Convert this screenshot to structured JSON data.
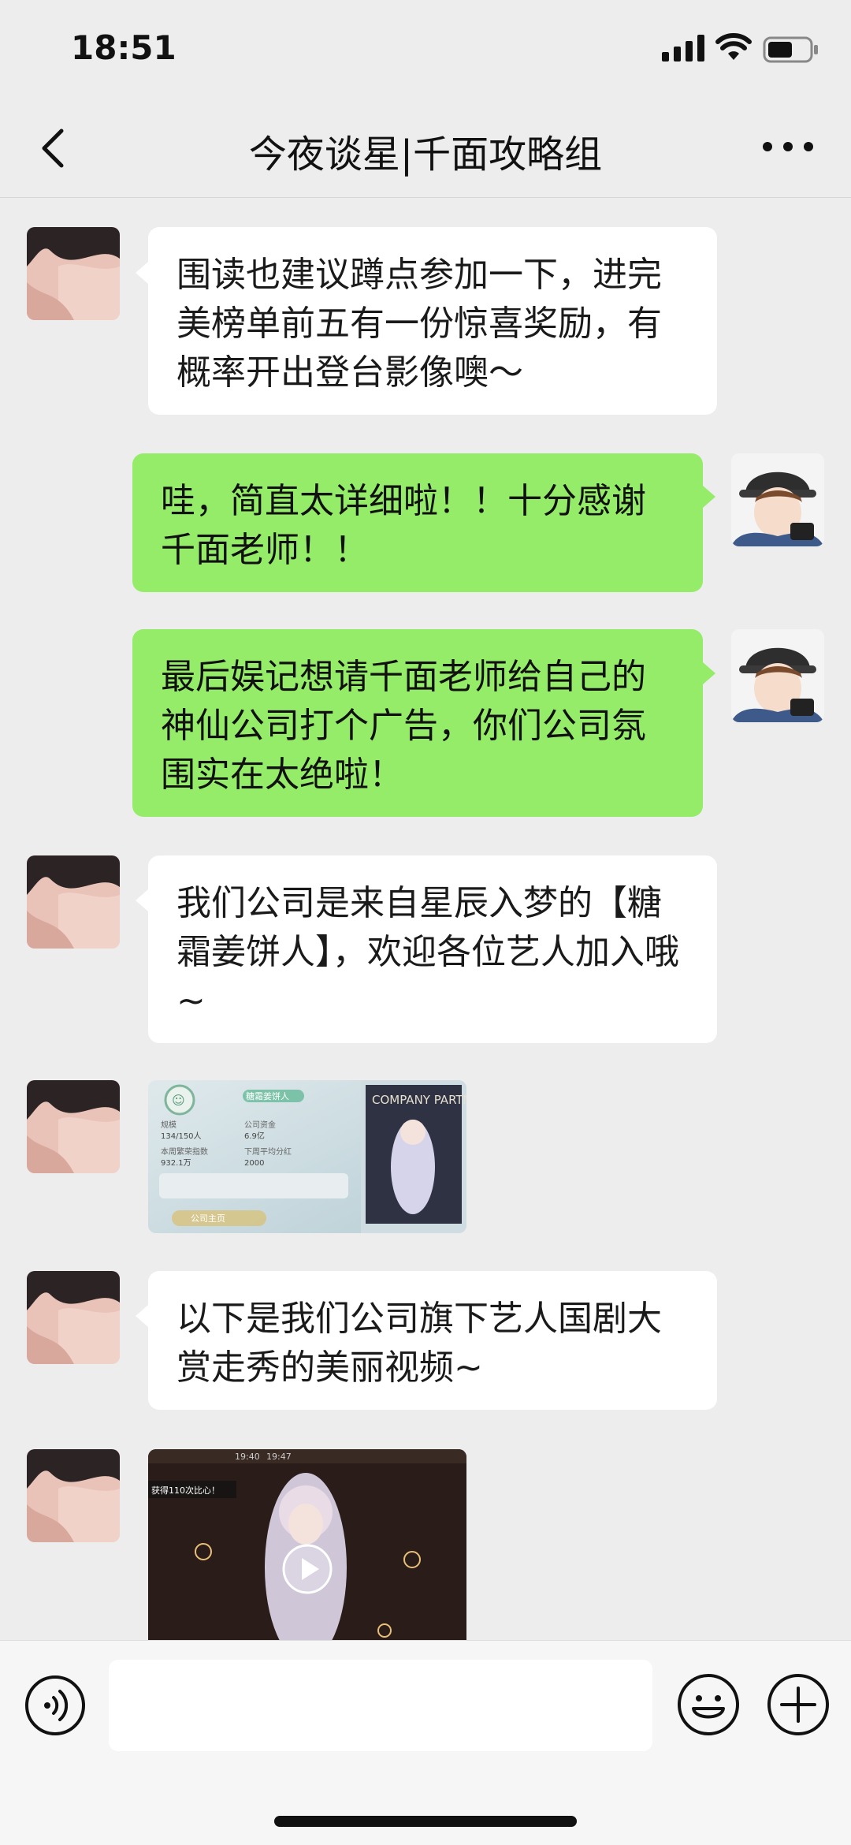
{
  "status_bar": {
    "time": "18:51"
  },
  "header": {
    "title": "今夜谈星|千面攻略组"
  },
  "messages": [
    {
      "side": "left",
      "text": "围读也建议蹲点参加一下，进完美榜单前五有一份惊喜奖励，有概率开出登台影像噢～"
    },
    {
      "side": "right",
      "text": "哇，简直太详细啦！！十分感谢千面老师！！"
    },
    {
      "side": "right",
      "text": "最后娱记想请千面老师给自己的神仙公司打个广告，你们公司氛围实在太绝啦！"
    },
    {
      "side": "left",
      "text": "我们公司是来自星辰入梦的【糖霜姜饼人】，欢迎各位艺人加入哦~"
    },
    {
      "side": "left",
      "type": "image",
      "image": {
        "company_name": "糖霜姜饼人",
        "poster_title": "COMPANY PARTNER",
        "stats": [
          {
            "label": "规模",
            "value": "134/150人"
          },
          {
            "label": "公司资金",
            "value": "6.9亿"
          },
          {
            "label": "本周繁荣指数",
            "value": "932.1万"
          },
          {
            "label": "下周平均分红",
            "value": "2000"
          }
        ],
        "button": "公司主页"
      }
    },
    {
      "side": "left",
      "text": "以下是我们公司旗下艺人国剧大赏走秀的美丽视频~"
    },
    {
      "side": "left",
      "type": "video",
      "video": {
        "time_a": "19:40",
        "time_b": "19:47",
        "banner": "获得110次比心！"
      }
    }
  ],
  "icons": {
    "back": "chevron-left-icon",
    "more": "more-dots-icon",
    "voice": "voice-icon",
    "emoji": "emoji-icon",
    "plus": "plus-icon"
  },
  "colors": {
    "background": "#ededed",
    "bubble_self": "#95ec69",
    "bubble_other": "#ffffff"
  }
}
